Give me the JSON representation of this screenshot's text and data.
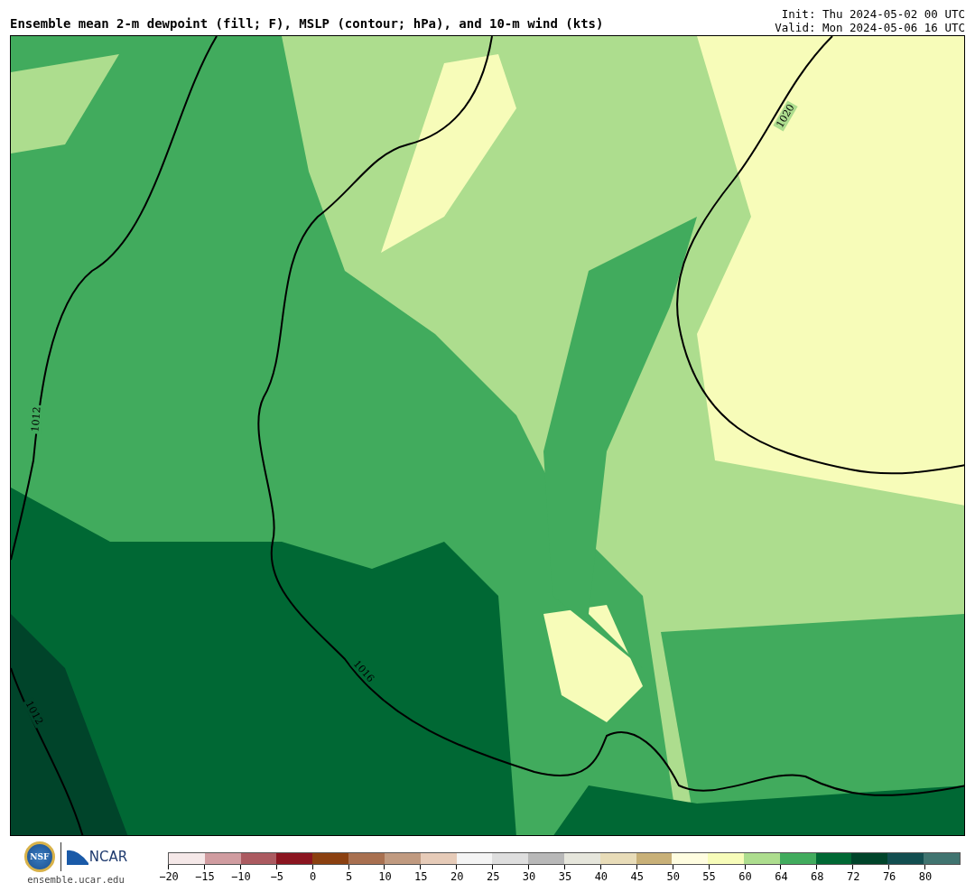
{
  "title": "Ensemble mean 2-m dewpoint (fill; F), MSLP (contour; hPa), and 10-m wind (kts)",
  "init": "Init: Thu 2024-05-02 00 UTC",
  "valid": "Valid: Mon 2024-05-06 16 UTC",
  "map": {
    "contour_labels": [
      "1020",
      "1012",
      "1016",
      "1012"
    ]
  },
  "logos": {
    "nsf": "NSF",
    "ncar": "NCAR",
    "url": "ensemble.ucar.edu"
  },
  "colorbar": [
    {
      "label": "−20",
      "color": "#f5e8e8"
    },
    {
      "label": "−15",
      "color": "#d09ca0"
    },
    {
      "label": "−10",
      "color": "#ab5a60"
    },
    {
      "label": "−5",
      "color": "#8b1520"
    },
    {
      "label": "0",
      "color": "#8b4010"
    },
    {
      "label": "5",
      "color": "#a87050"
    },
    {
      "label": "10",
      "color": "#c09a80"
    },
    {
      "label": "15",
      "color": "#e6cbb8"
    },
    {
      "label": "20",
      "color": "#f4f4f4"
    },
    {
      "label": "25",
      "color": "#dedede"
    },
    {
      "label": "30",
      "color": "#b8b8b8"
    },
    {
      "label": "35",
      "color": "#e6e6dc"
    },
    {
      "label": "40",
      "color": "#e8dcb8"
    },
    {
      "label": "45",
      "color": "#c8b078"
    },
    {
      "label": "50",
      "color": "#fffde0"
    },
    {
      "label": "55",
      "color": "#f7fcb9"
    },
    {
      "label": "60",
      "color": "#addd8e"
    },
    {
      "label": "64",
      "color": "#41ab5d"
    },
    {
      "label": "68",
      "color": "#006834"
    },
    {
      "label": "72",
      "color": "#00442a"
    },
    {
      "label": "76",
      "color": "#124e50"
    },
    {
      "label": "80",
      "color": "#407470"
    }
  ]
}
